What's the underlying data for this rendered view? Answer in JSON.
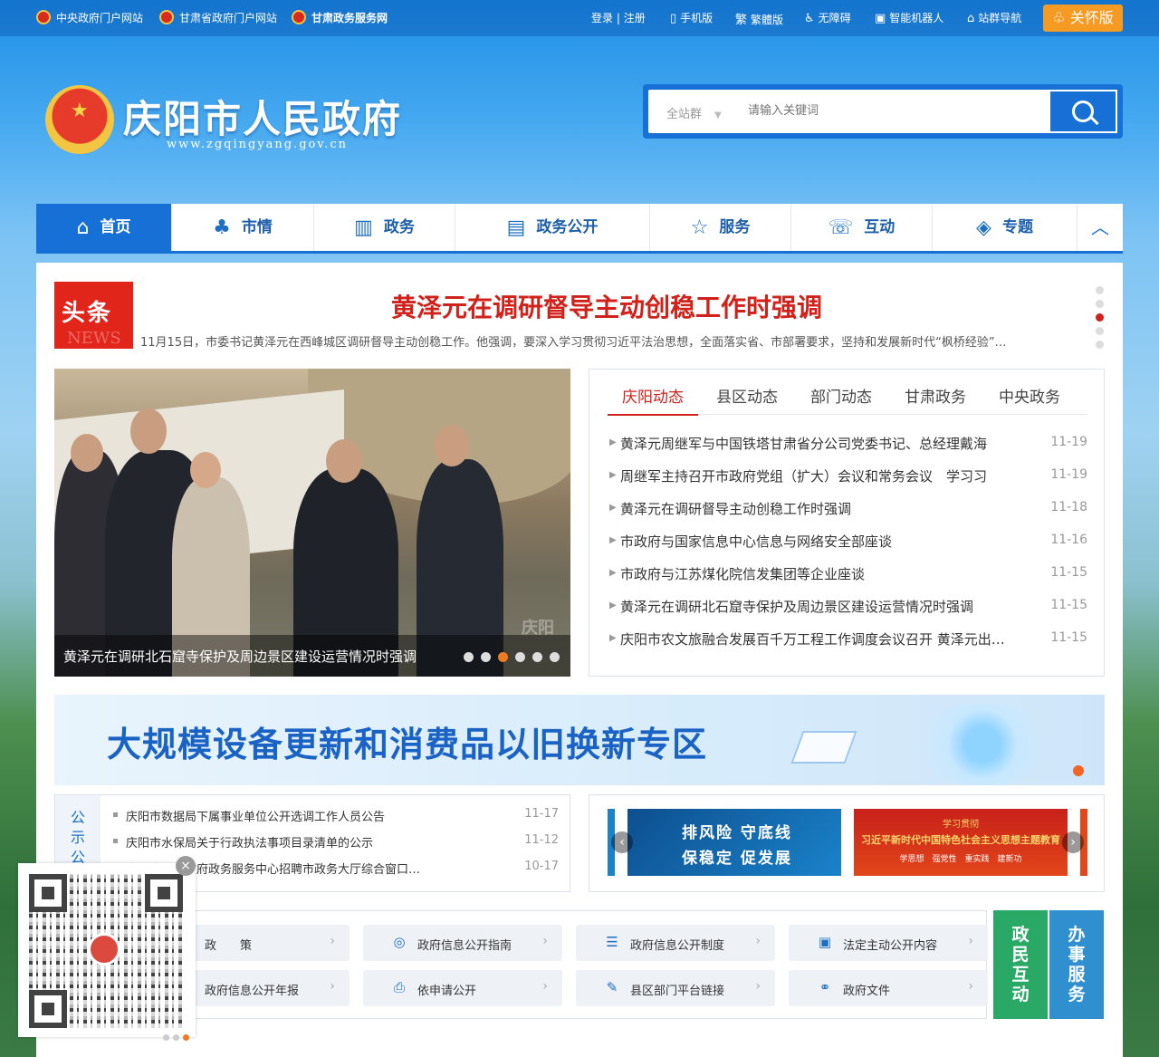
{
  "topbar": {
    "links": [
      {
        "label": "中央政府门户网站"
      },
      {
        "label": "甘肃省政府门户网站"
      },
      {
        "label": "甘肃政务服务网"
      }
    ],
    "login": "登录",
    "separator": "|",
    "register": "注册",
    "mobile": "手机版",
    "traditional": "繁體版",
    "accessible": "无障碍",
    "robot": "智能机器人",
    "site_nav": "站群导航",
    "care": "关怀版"
  },
  "header": {
    "title": "庆阳市人民政府",
    "url": "www.zgqingyang.gov.cn"
  },
  "search": {
    "scope": "全站群",
    "placeholder": "请输入关键词"
  },
  "nav": {
    "items": [
      {
        "label": "首页",
        "icon": "home-icon"
      },
      {
        "label": "市情",
        "icon": "landmark-icon"
      },
      {
        "label": "政务",
        "icon": "chart-icon"
      },
      {
        "label": "政务公开",
        "icon": "document-icon"
      },
      {
        "label": "服务",
        "icon": "star-icon"
      },
      {
        "label": "互动",
        "icon": "chat-icon"
      },
      {
        "label": "专题",
        "icon": "layers-icon"
      }
    ]
  },
  "headline": {
    "badge": "头条",
    "badge_sub": "NEWS",
    "title": "黄泽元在调研督导主动创稳工作时强调",
    "summary": "11月15日，市委书记黄泽元在西峰城区调研督导主动创稳工作。他强调，要深入学习贯彻习近平法治思想，全面落实省、市部署要求，坚持和发展新时代“枫桥经验”…"
  },
  "carousel": {
    "caption": "黄泽元在调研北石窟寺保护及周边景区建设运营情况时强调",
    "watermark": "庆阳",
    "slide_count": 6,
    "active_index": 2
  },
  "news": {
    "tabs": [
      "庆阳动态",
      "县区动态",
      "部门动态",
      "甘肃政务",
      "中央政务"
    ],
    "items": [
      {
        "title": "黄泽元周继军与中国铁塔甘肃省分公司党委书记、总经理戴海",
        "date": "11-19"
      },
      {
        "title": "周继军主持召开市政府党组（扩大）会议和常务会议　学习习",
        "date": "11-19"
      },
      {
        "title": "黄泽元在调研督导主动创稳工作时强调",
        "date": "11-18"
      },
      {
        "title": "市政府与国家信息中心信息与网络安全部座谈",
        "date": "11-16"
      },
      {
        "title": "市政府与江苏煤化院信发集团等企业座谈",
        "date": "11-15"
      },
      {
        "title": "黄泽元在调研北石窟寺保护及周边景区建设运营情况时强调",
        "date": "11-15"
      },
      {
        "title": "庆阳市农文旅融合发展百千万工程工作调度会议召开 黄泽元出…",
        "date": "11-15"
      }
    ]
  },
  "banner": {
    "text": "大规模设备更新和消费品以旧换新专区"
  },
  "notices": {
    "label": "公示公告",
    "items": [
      {
        "title": "庆阳市数据局下属事业单位公开选调工作人员公告",
        "date": "11-17"
      },
      {
        "title": "庆阳市水保局关于行政执法事项目录清单的公示",
        "date": "11-12"
      },
      {
        "title": "庆阳市人民政府政务服务中心招聘市政务大厅综合窗口…",
        "date": "10-17"
      }
    ]
  },
  "promo": {
    "card1_line1": "排风险 守底线",
    "card1_line2": "保稳定 促发展",
    "card2_line1": "学习贯彻",
    "card2_line2": "习近平新时代中国特色社会主义思想主题教育",
    "card2_line3": "学思想　强党性　重实践　建新功"
  },
  "disclosure": {
    "buttons": [
      {
        "label": "政　　策",
        "icon": "policy-icon"
      },
      {
        "label": "政府信息公开指南",
        "icon": "compass-icon"
      },
      {
        "label": "政府信息公开制度",
        "icon": "list-icon"
      },
      {
        "label": "法定主动公开内容",
        "icon": "clipboard-icon"
      },
      {
        "label": "政府信息公开年报",
        "icon": "report-icon"
      },
      {
        "label": "依申请公开",
        "icon": "apply-icon"
      },
      {
        "label": "县区部门平台链接",
        "icon": "edit-icon"
      },
      {
        "label": "政府文件",
        "icon": "link-icon"
      }
    ]
  },
  "side": {
    "interact": "政民互动",
    "service": "办事服务"
  },
  "qr": {
    "slide_count": 3,
    "active_index": 2
  },
  "colors": {
    "primary": "#1670d6",
    "headline_red": "#d0211a",
    "care_orange": "#f59a23",
    "interact_green": "#2aa866",
    "service_blue": "#2f8fcf"
  }
}
